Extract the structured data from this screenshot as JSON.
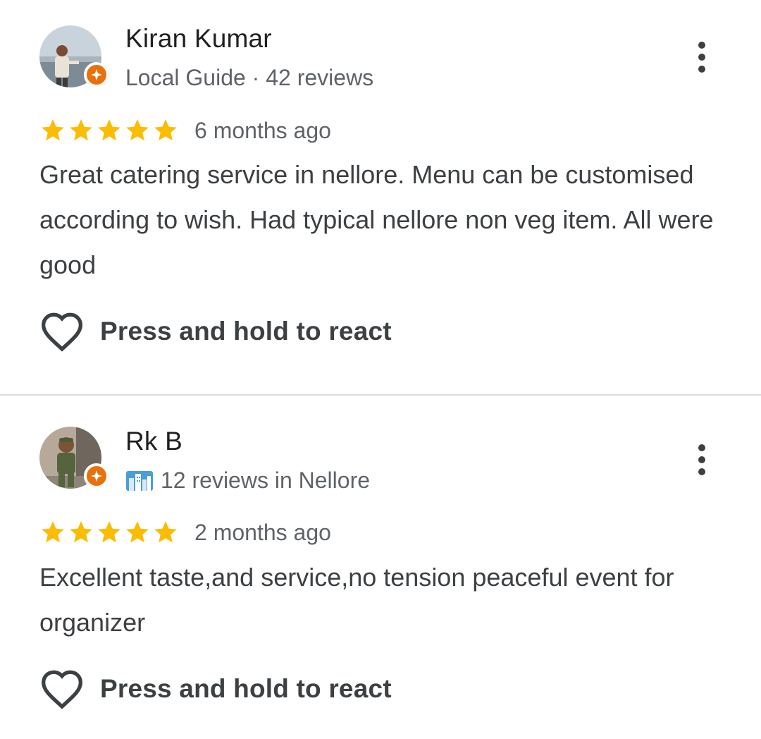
{
  "reviews": [
    {
      "name": "Kiran Kumar",
      "meta": "Local Guide · 42 reviews",
      "rating": 5,
      "date": "6 months ago",
      "text": "Great catering service in nellore. Menu can be customised according to wish. Had typical nellore non veg item. All were good",
      "react_label": "Press and hold to react",
      "avatar_icon": "profile-photo",
      "badge_icon": "local-guide-star-icon"
    },
    {
      "name": "Rk B",
      "meta": "12 reviews in Nellore",
      "meta_icon": "city-icon",
      "rating": 5,
      "date": "2 months ago",
      "text": "Excellent taste,and service,no tension peaceful event for organizer",
      "react_label": "Press and hold to react",
      "avatar_icon": "profile-photo",
      "badge_icon": "local-guide-star-icon"
    }
  ],
  "colors": {
    "star": "#fbbc04",
    "badge": "#e8710a",
    "text_secondary": "#5f6368",
    "divider": "#dadce0"
  }
}
